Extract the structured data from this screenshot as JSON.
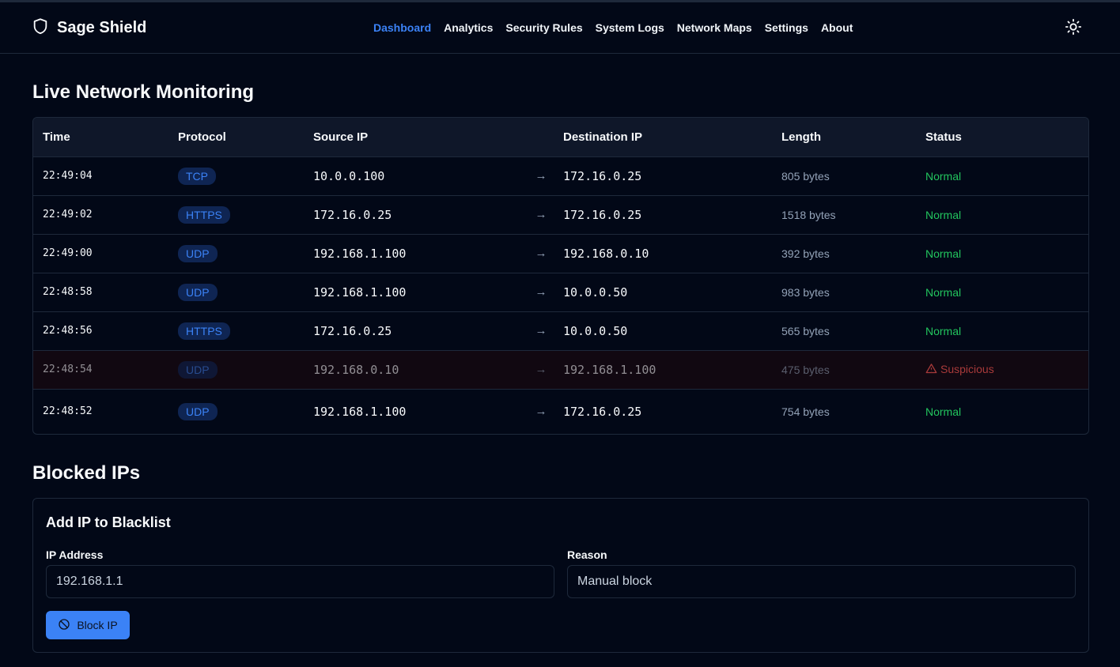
{
  "app": {
    "name": "Sage Shield",
    "brand_icon": "shield-icon",
    "theme_icon": "sun-icon"
  },
  "nav": {
    "items": [
      {
        "label": "Dashboard",
        "active": true
      },
      {
        "label": "Analytics",
        "active": false
      },
      {
        "label": "Security Rules",
        "active": false
      },
      {
        "label": "System Logs",
        "active": false
      },
      {
        "label": "Network Maps",
        "active": false
      },
      {
        "label": "Settings",
        "active": false
      },
      {
        "label": "About",
        "active": false
      }
    ]
  },
  "monitoring": {
    "title": "Live Network Monitoring",
    "columns": [
      "Time",
      "Protocol",
      "Source IP",
      "Destination IP",
      "Length",
      "Status"
    ],
    "rows": [
      {
        "time": "22:49:04",
        "protocol": "TCP",
        "source": "10.0.0.100",
        "destination": "172.16.0.25",
        "length": "805 bytes",
        "status": "Normal"
      },
      {
        "time": "22:49:02",
        "protocol": "HTTPS",
        "source": "172.16.0.25",
        "destination": "172.16.0.25",
        "length": "1518 bytes",
        "status": "Normal"
      },
      {
        "time": "22:49:00",
        "protocol": "UDP",
        "source": "192.168.1.100",
        "destination": "192.168.0.10",
        "length": "392 bytes",
        "status": "Normal"
      },
      {
        "time": "22:48:58",
        "protocol": "UDP",
        "source": "192.168.1.100",
        "destination": "10.0.0.50",
        "length": "983 bytes",
        "status": "Normal"
      },
      {
        "time": "22:48:56",
        "protocol": "HTTPS",
        "source": "172.16.0.25",
        "destination": "10.0.0.50",
        "length": "565 bytes",
        "status": "Normal"
      },
      {
        "time": "22:48:54",
        "protocol": "UDP",
        "source": "192.168.0.10",
        "destination": "192.168.1.100",
        "length": "475 bytes",
        "status": "Suspicious"
      },
      {
        "time": "22:48:52",
        "protocol": "UDP",
        "source": "192.168.1.100",
        "destination": "172.16.0.25",
        "length": "754 bytes",
        "status": "Normal"
      }
    ]
  },
  "blocked": {
    "title": "Blocked IPs",
    "card_title": "Add IP to Blacklist",
    "ip_label": "IP Address",
    "ip_placeholder": "192.168.1.1",
    "reason_label": "Reason",
    "reason_placeholder": "Manual block",
    "button_label": "Block IP",
    "button_icon": "ban-icon"
  },
  "colors": {
    "background": "#020817",
    "accent": "#3b82f6",
    "normal": "#22c55e",
    "suspicious": "#a83a3a"
  }
}
